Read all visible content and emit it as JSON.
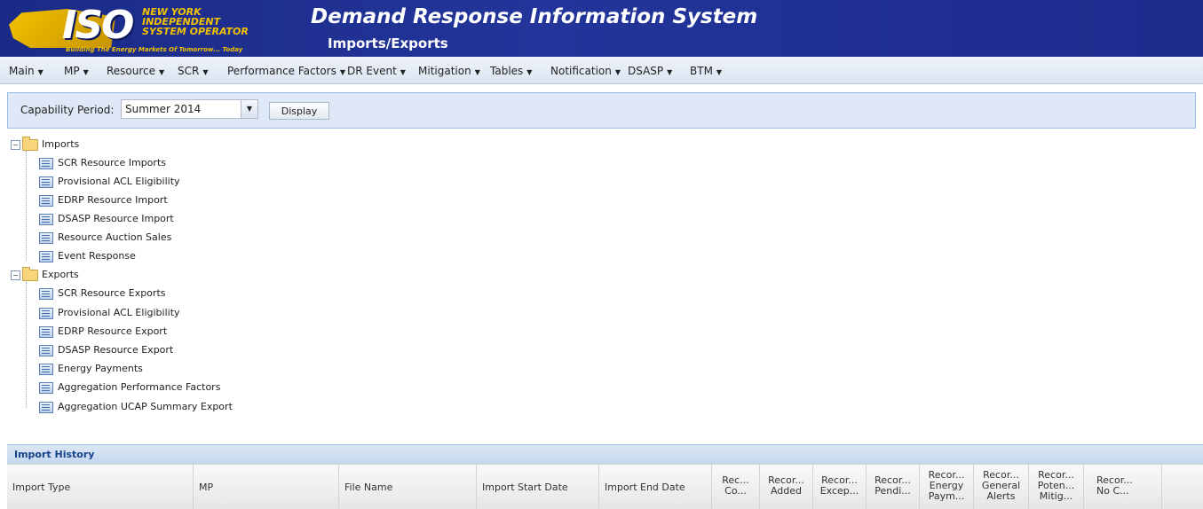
{
  "header": {
    "logo_text": "ISO",
    "logo_org": "NEW YORK\nINDEPENDENT\nSYSTEM OPERATOR",
    "logo_tagline": "Building The Energy Markets Of Tomorrow... Today",
    "app_title": "Demand Response Information System",
    "page_title": "Imports/Exports"
  },
  "menu": [
    {
      "label": "Main",
      "icon": "chevron-down-icon"
    },
    {
      "label": "MP",
      "icon": "chevron-down-icon"
    },
    {
      "label": "Resource",
      "icon": "chevron-down-icon"
    },
    {
      "label": "SCR",
      "icon": "chevron-down-icon"
    },
    {
      "label": "Performance Factors",
      "icon": "chevron-down-icon"
    },
    {
      "label": "DR Event",
      "icon": "chevron-down-icon"
    },
    {
      "label": "Mitigation",
      "icon": "chevron-down-icon"
    },
    {
      "label": "Tables",
      "icon": "chevron-down-icon"
    },
    {
      "label": "Notification",
      "icon": "chevron-down-icon"
    },
    {
      "label": "DSASP",
      "icon": "chevron-down-icon"
    },
    {
      "label": "BTM",
      "icon": "chevron-down-icon"
    }
  ],
  "capability": {
    "label": "Capability Period:",
    "selected": "Summer 2014",
    "display_button": "Display"
  },
  "tree": {
    "imports": {
      "label": "Imports",
      "items": [
        "SCR Resource Imports",
        "Provisional ACL Eligibility",
        "EDRP Resource Import",
        "DSASP Resource Import",
        "Resource Auction Sales",
        "Event Response"
      ]
    },
    "exports": {
      "label": "Exports",
      "items": [
        "SCR Resource Exports",
        "Provisional ACL Eligibility",
        "EDRP Resource Export",
        "DSASP Resource Export",
        "Energy Payments",
        "Aggregation Performance Factors",
        "Aggregation UCAP Summary Export"
      ]
    }
  },
  "import_history": {
    "title": "Import History",
    "columns": [
      "Import Type",
      "MP",
      "File Name",
      "Import Start Date",
      "Import End Date",
      "Rec...\nCo...",
      "Recor...\nAdded",
      "Recor...\nExcep...",
      "Recor...\nPendi...",
      "Recor...\nEnergy\nPaym...",
      "Recor...\nGeneral\nAlerts",
      "Recor...\nPoten...\nMitig...",
      "Recor...\nNo C..."
    ]
  }
}
